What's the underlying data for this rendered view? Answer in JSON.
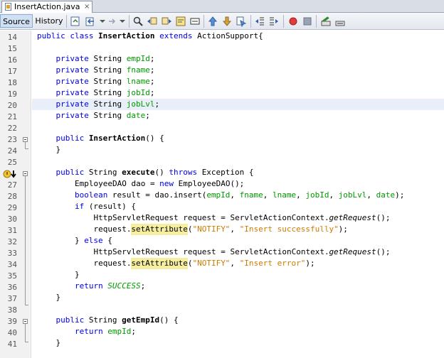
{
  "file_tab": {
    "name": "InsertAction.java",
    "close": "×"
  },
  "view_tabs": {
    "source": "Source",
    "history": "History"
  },
  "toolbar_icons": [
    "last-edit-icon",
    "back-icon",
    "forward-icon",
    "find-selection-icon",
    "find-previous-icon",
    "find-next-icon",
    "toggle-highlight-icon",
    "toggle-rectangle-icon",
    "previous-bookmark-icon",
    "next-bookmark-icon",
    "toggle-bookmark-icon",
    "shift-left-icon",
    "shift-right-icon",
    "start-macro-icon",
    "stop-macro-icon",
    "comment-icon",
    "uncomment-icon"
  ],
  "colors": {
    "keyword": "#0000e6",
    "field": "#009900",
    "string": "#ce7b00",
    "mark_occurrence": "#f5eea0",
    "current_line": "#e9eff8"
  },
  "editor": {
    "lines": [
      {
        "n": "14",
        "tokens": [
          {
            "t": "public class ",
            "c": "kw"
          },
          {
            "t": "InsertAction",
            "c": "mb"
          },
          {
            "t": " extends ",
            "c": "kw"
          },
          {
            "t": "ActionSupport{",
            "c": ""
          }
        ]
      },
      {
        "n": "15",
        "tokens": []
      },
      {
        "n": "16",
        "tokens": [
          {
            "t": "    private ",
            "c": "kw"
          },
          {
            "t": "String ",
            "c": ""
          },
          {
            "t": "empId",
            "c": "fd"
          },
          {
            "t": ";",
            "c": ""
          }
        ]
      },
      {
        "n": "17",
        "tokens": [
          {
            "t": "    private ",
            "c": "kw"
          },
          {
            "t": "String ",
            "c": ""
          },
          {
            "t": "fname",
            "c": "fd"
          },
          {
            "t": ";",
            "c": ""
          }
        ]
      },
      {
        "n": "18",
        "tokens": [
          {
            "t": "    private ",
            "c": "kw"
          },
          {
            "t": "String ",
            "c": ""
          },
          {
            "t": "lname",
            "c": "fd"
          },
          {
            "t": ";",
            "c": ""
          }
        ]
      },
      {
        "n": "19",
        "tokens": [
          {
            "t": "    private ",
            "c": "kw"
          },
          {
            "t": "String ",
            "c": ""
          },
          {
            "t": "jobId",
            "c": "fd"
          },
          {
            "t": ";",
            "c": ""
          }
        ]
      },
      {
        "n": "20",
        "tokens": [
          {
            "t": "    private ",
            "c": "kw"
          },
          {
            "t": "String ",
            "c": ""
          },
          {
            "t": "jobLvl",
            "c": "fd"
          },
          {
            "t": ";",
            "c": ""
          }
        ]
      },
      {
        "n": "21",
        "tokens": [
          {
            "t": "    private ",
            "c": "kw"
          },
          {
            "t": "String ",
            "c": ""
          },
          {
            "t": "date",
            "c": "fd"
          },
          {
            "t": ";",
            "c": ""
          }
        ]
      },
      {
        "n": "22",
        "tokens": []
      },
      {
        "n": "23",
        "tokens": [
          {
            "t": "    public ",
            "c": "kw"
          },
          {
            "t": "InsertAction",
            "c": "mb"
          },
          {
            "t": "() {",
            "c": ""
          }
        ]
      },
      {
        "n": "24",
        "tokens": [
          {
            "t": "    }",
            "c": ""
          }
        ]
      },
      {
        "n": "25",
        "tokens": []
      },
      {
        "n": "26",
        "tokens": [
          {
            "t": "    public ",
            "c": "kw"
          },
          {
            "t": "String ",
            "c": ""
          },
          {
            "t": "execute",
            "c": "mb"
          },
          {
            "t": "() ",
            "c": ""
          },
          {
            "t": "throws ",
            "c": "kw"
          },
          {
            "t": "Exception {",
            "c": ""
          }
        ]
      },
      {
        "n": "27",
        "tokens": [
          {
            "t": "        EmployeeDAO dao = ",
            "c": ""
          },
          {
            "t": "new ",
            "c": "kw"
          },
          {
            "t": "EmployeeDAO();",
            "c": ""
          }
        ]
      },
      {
        "n": "28",
        "tokens": [
          {
            "t": "        boolean ",
            "c": "kw"
          },
          {
            "t": "result = dao.insert(",
            "c": ""
          },
          {
            "t": "empId",
            "c": "fd"
          },
          {
            "t": ", ",
            "c": ""
          },
          {
            "t": "fname",
            "c": "fd"
          },
          {
            "t": ", ",
            "c": ""
          },
          {
            "t": "lname",
            "c": "fd"
          },
          {
            "t": ", ",
            "c": ""
          },
          {
            "t": "jobId",
            "c": "fd"
          },
          {
            "t": ", ",
            "c": ""
          },
          {
            "t": "jobLvl",
            "c": "fd"
          },
          {
            "t": ", ",
            "c": ""
          },
          {
            "t": "date",
            "c": "fd"
          },
          {
            "t": ");",
            "c": ""
          }
        ]
      },
      {
        "n": "29",
        "tokens": [
          {
            "t": "        if ",
            "c": "kw"
          },
          {
            "t": "(result) {",
            "c": ""
          }
        ]
      },
      {
        "n": "30",
        "tokens": [
          {
            "t": "            HttpServletRequest request = ServletActionContext.",
            "c": ""
          },
          {
            "t": "getRequest",
            "c": "mi"
          },
          {
            "t": "();",
            "c": ""
          }
        ]
      },
      {
        "n": "31",
        "tokens": [
          {
            "t": "            request.",
            "c": ""
          },
          {
            "t": "setAttribute",
            "c": "mk"
          },
          {
            "t": "(",
            "c": ""
          },
          {
            "t": "\"NOTIFY\"",
            "c": "st"
          },
          {
            "t": ", ",
            "c": ""
          },
          {
            "t": "\"Insert successfully\"",
            "c": "st"
          },
          {
            "t": ");",
            "c": ""
          }
        ]
      },
      {
        "n": "32",
        "tokens": [
          {
            "t": "        } ",
            "c": ""
          },
          {
            "t": "else ",
            "c": "kw"
          },
          {
            "t": "{",
            "c": ""
          }
        ]
      },
      {
        "n": "33",
        "tokens": [
          {
            "t": "            HttpServletRequest request = ServletActionContext.",
            "c": ""
          },
          {
            "t": "getRequest",
            "c": "mi"
          },
          {
            "t": "();",
            "c": ""
          }
        ]
      },
      {
        "n": "34",
        "tokens": [
          {
            "t": "            request.",
            "c": ""
          },
          {
            "t": "setAttribute",
            "c": "mk"
          },
          {
            "t": "(",
            "c": ""
          },
          {
            "t": "\"NOTIFY\"",
            "c": "st"
          },
          {
            "t": ", ",
            "c": ""
          },
          {
            "t": "\"Insert error\"",
            "c": "st"
          },
          {
            "t": ");",
            "c": ""
          }
        ]
      },
      {
        "n": "35",
        "tokens": [
          {
            "t": "        }",
            "c": ""
          }
        ]
      },
      {
        "n": "36",
        "tokens": [
          {
            "t": "        return ",
            "c": "kw"
          },
          {
            "t": "SUCCESS",
            "c": "cs"
          },
          {
            "t": ";",
            "c": ""
          }
        ]
      },
      {
        "n": "37",
        "tokens": [
          {
            "t": "    }",
            "c": ""
          }
        ]
      },
      {
        "n": "38",
        "tokens": []
      },
      {
        "n": "39",
        "tokens": [
          {
            "t": "    public ",
            "c": "kw"
          },
          {
            "t": "String ",
            "c": ""
          },
          {
            "t": "getEmpId",
            "c": "mb"
          },
          {
            "t": "() {",
            "c": ""
          }
        ]
      },
      {
        "n": "40",
        "tokens": [
          {
            "t": "        return ",
            "c": "kw"
          },
          {
            "t": "empId",
            "c": "fd"
          },
          {
            "t": ";",
            "c": ""
          }
        ]
      },
      {
        "n": "41",
        "tokens": [
          {
            "t": "    }",
            "c": ""
          }
        ]
      }
    ]
  }
}
